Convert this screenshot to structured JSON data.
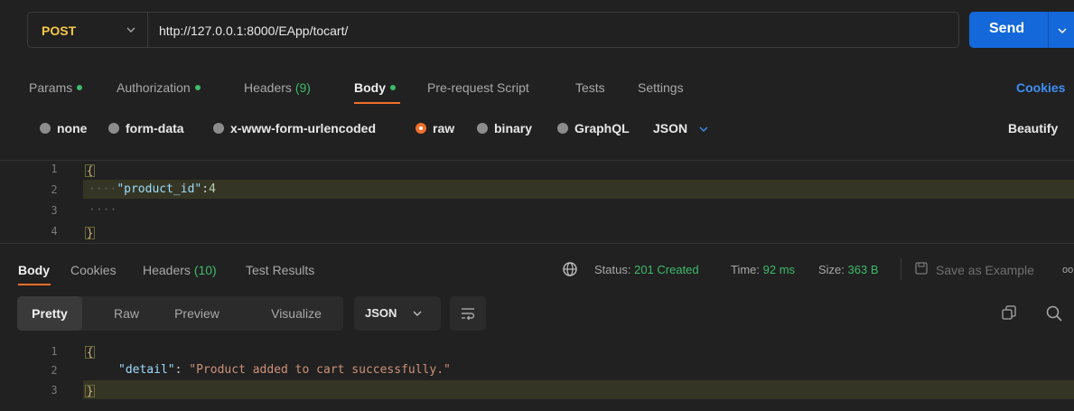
{
  "request": {
    "method": "POST",
    "url": "http://127.0.0.1:8000/EApp/tocart/",
    "send_label": "Send"
  },
  "request_tabs": {
    "params": "Params",
    "authorization": "Authorization",
    "headers": "Headers",
    "headers_count": "(9)",
    "body": "Body",
    "pre_request": "Pre-request Script",
    "tests": "Tests",
    "settings": "Settings",
    "cookies": "Cookies"
  },
  "body_types": {
    "none": "none",
    "form_data": "form-data",
    "urlencoded": "x-www-form-urlencoded",
    "raw": "raw",
    "binary": "binary",
    "graphql": "GraphQL",
    "format": "JSON",
    "beautify": "Beautify"
  },
  "request_body": {
    "line_numbers": [
      "1",
      "2",
      "3",
      "4"
    ],
    "brace_open": "{",
    "indent_dots": "····",
    "key": "\"product_id\"",
    "colon": ":",
    "value": "4",
    "line3_dots": "····",
    "brace_close": "}"
  },
  "response_tabs": {
    "body": "Body",
    "cookies": "Cookies",
    "headers": "Headers",
    "headers_count": "(10)",
    "test_results": "Test Results"
  },
  "response_meta": {
    "status_label": "Status:",
    "status_value": "201 Created",
    "time_label": "Time:",
    "time_value": "92 ms",
    "size_label": "Size:",
    "size_value": "363 B",
    "save_example": "Save as Example",
    "more": "oo"
  },
  "response_view": {
    "pretty": "Pretty",
    "raw": "Raw",
    "preview": "Preview",
    "visualize": "Visualize",
    "format": "JSON"
  },
  "response_body": {
    "line_numbers": [
      "1",
      "2",
      "3"
    ],
    "brace_open": "{",
    "key": "\"detail\"",
    "colon": ": ",
    "value": "\"Product added to cart successfully.\"",
    "brace_close": "}"
  },
  "colors": {
    "accent": "#ef6f2b",
    "send": "#1468d9",
    "status_green": "#3dbb6b",
    "method_yellow": "#f7c948",
    "link_blue": "#3d8ff5"
  }
}
